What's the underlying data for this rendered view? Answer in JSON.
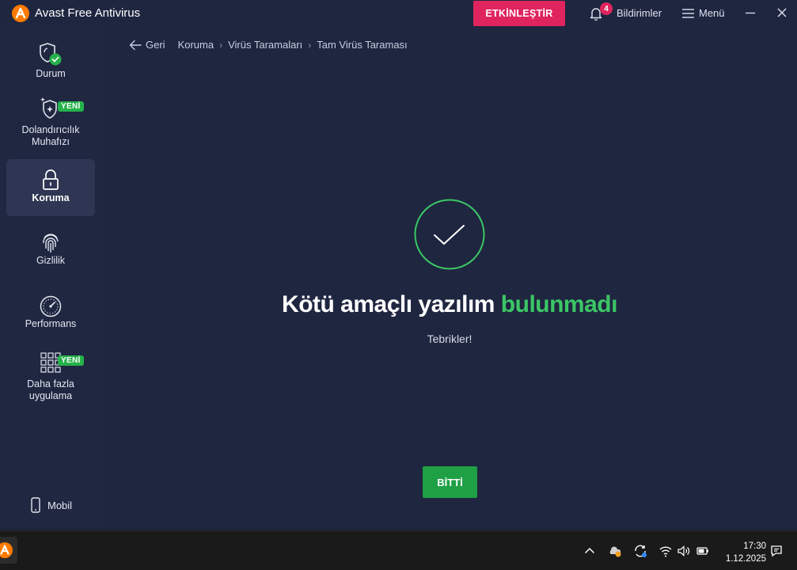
{
  "app": {
    "title": "Avast Free Antivirus",
    "activate_label": "ETKİNLEŞTİR",
    "notifications_label": "Bildirimler",
    "notifications_count": "4",
    "menu_label": "Menü"
  },
  "sidebar": {
    "items": [
      {
        "label": "Durum"
      },
      {
        "label": "Dolandırıcılık",
        "label2": "Muhafızı",
        "badge": "YENİ"
      },
      {
        "label": "Koruma"
      },
      {
        "label": "Gizlilik"
      },
      {
        "label": "Performans"
      },
      {
        "label": "Daha fazla",
        "label2": "uygulama",
        "badge": "YENİ"
      }
    ],
    "mobile_label": "Mobil"
  },
  "breadcrumb": {
    "back_label": "Geri",
    "items": [
      "Koruma",
      "Virüs Taramaları",
      "Tam Virüs Taraması"
    ]
  },
  "result": {
    "headline_part1": "Kötü amaçlı yazılım ",
    "headline_part2": "bulunmadı",
    "subtext": "Tebrikler!",
    "done_label": "BİTTİ"
  },
  "taskbar": {
    "time": "17:30",
    "date": "1.12.2025"
  },
  "colors": {
    "accent_pink": "#e0245e",
    "success_green": "#3bc765",
    "button_green": "#1fa045",
    "background": "#1f2640"
  }
}
